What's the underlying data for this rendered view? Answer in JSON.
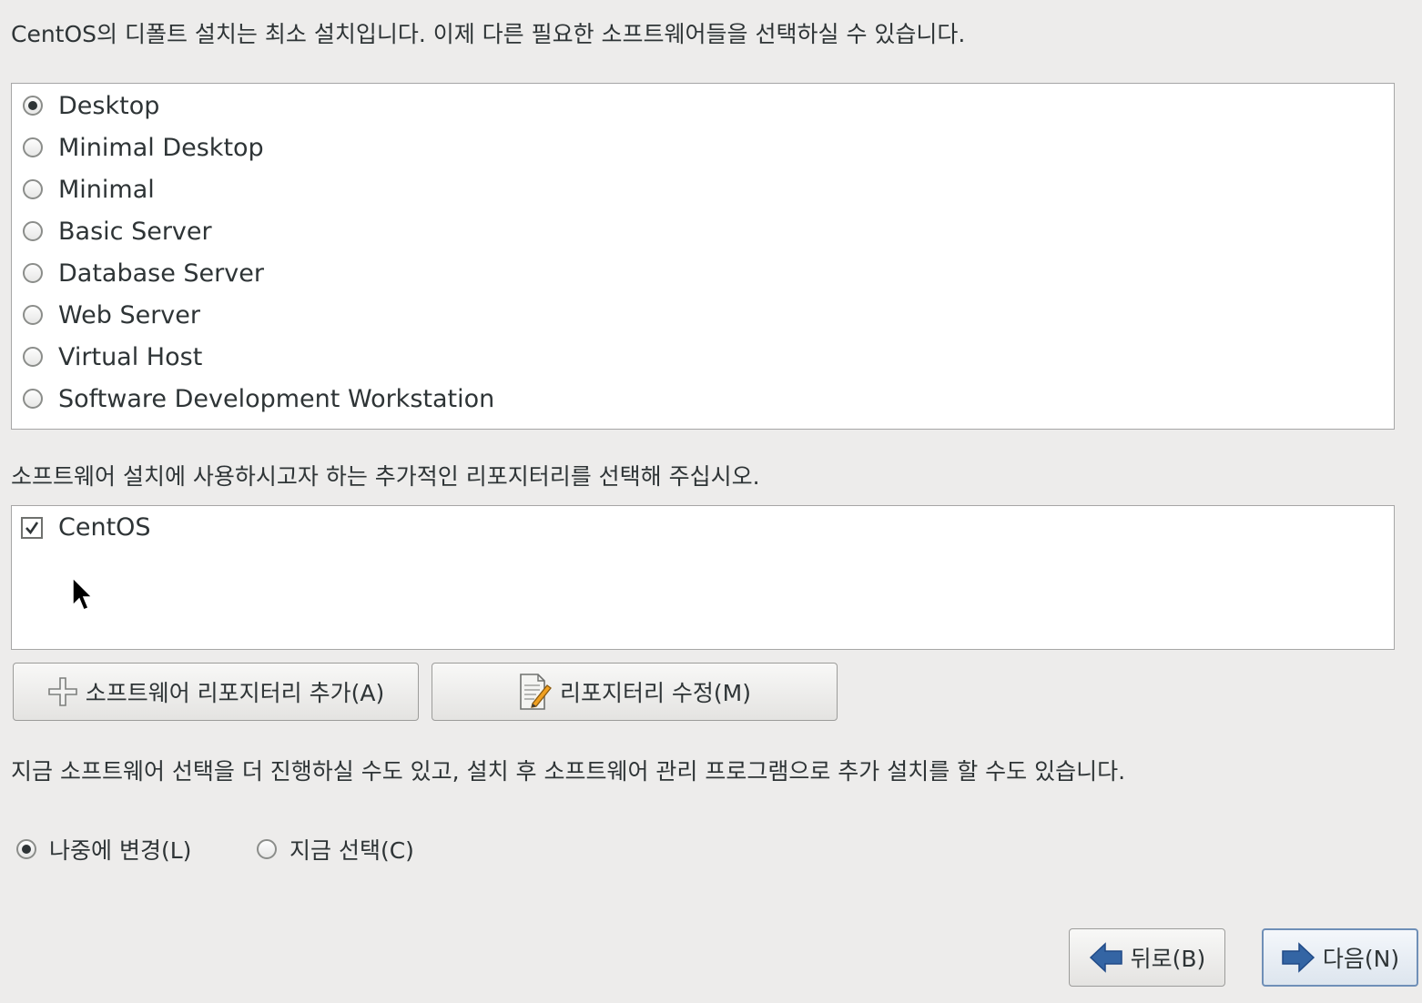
{
  "intro_text": "CentOS의 디폴트 설치는 최소 설치입니다. 이제 다른 필요한 소프트웨어들을 선택하실 수 있습니다.",
  "install_groups": {
    "selected": "Desktop",
    "options": [
      {
        "label": "Desktop",
        "checked": true
      },
      {
        "label": "Minimal Desktop",
        "checked": false
      },
      {
        "label": "Minimal",
        "checked": false
      },
      {
        "label": "Basic Server",
        "checked": false
      },
      {
        "label": "Database Server",
        "checked": false
      },
      {
        "label": "Web Server",
        "checked": false
      },
      {
        "label": "Virtual Host",
        "checked": false
      },
      {
        "label": "Software Development Workstation",
        "checked": false
      }
    ]
  },
  "repo_section": {
    "caption": "소프트웨어 설치에 사용하시고자 하는 추가적인 리포지터리를 선택해 주십시오.",
    "repos": [
      {
        "label": "CentOS",
        "checked": true
      }
    ],
    "add_button": "소프트웨어 리포지터리 추가(A)",
    "edit_button": "리포지터리 수정(M)"
  },
  "customize": {
    "note": "지금 소프트웨어 선택을 더 진행하실 수도 있고, 설치 후 소프트웨어 관리 프로그램으로 추가 설치를 할 수도 있습니다.",
    "later_label": "나중에 변경(L)",
    "now_label": "지금 선택(C)",
    "selected": "later"
  },
  "nav": {
    "back_label": "뒤로(B)",
    "next_label": "다음(N)"
  },
  "icons": {
    "add": "plus-icon",
    "edit": "edit-document-icon",
    "back": "arrow-left-icon",
    "next": "arrow-right-icon",
    "cursor": "mouse-pointer-icon"
  },
  "colors": {
    "background": "#edeceb",
    "arrow_blue": "#3465a4",
    "text": "#2e3436"
  }
}
